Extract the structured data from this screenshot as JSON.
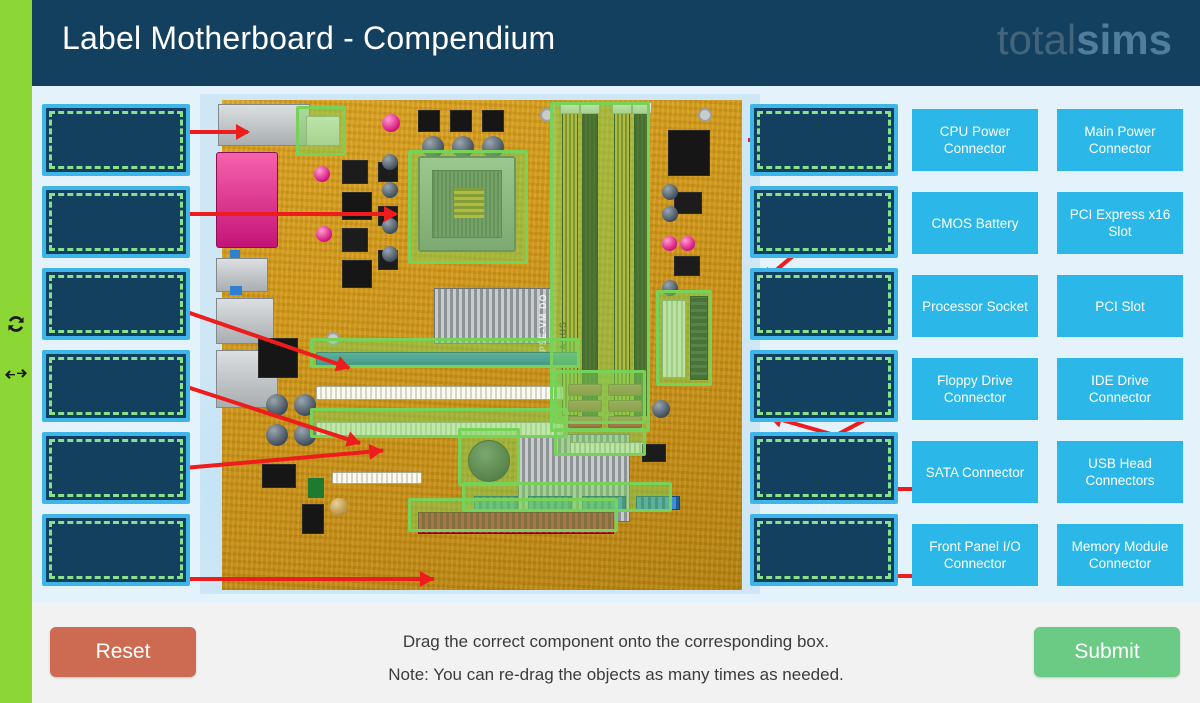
{
  "header": {
    "title": "Label Motherboard - Compendium",
    "logo_light": "total",
    "logo_bold": "sims"
  },
  "rail": {
    "icons": [
      {
        "name": "refresh-icon",
        "label": "refresh"
      },
      {
        "name": "collapse-icon",
        "label": "collapse"
      }
    ]
  },
  "options": [
    {
      "id": "cpu-power-connector",
      "label": "CPU Power Connector"
    },
    {
      "id": "main-power-connector",
      "label": "Main Power Connector"
    },
    {
      "id": "cmos-battery",
      "label": "CMOS Battery"
    },
    {
      "id": "pci-express-x16-slot",
      "label": "PCI Express x16 Slot"
    },
    {
      "id": "processor-socket",
      "label": "Processor Socket"
    },
    {
      "id": "pci-slot",
      "label": "PCI Slot"
    },
    {
      "id": "floppy-drive-connector",
      "label": "Floppy Drive Connector"
    },
    {
      "id": "ide-drive-connector",
      "label": "IDE Drive Connector"
    },
    {
      "id": "sata-connector",
      "label": "SATA Connector"
    },
    {
      "id": "usb-head-connectors",
      "label": "USB Head Connectors"
    },
    {
      "id": "front-panel-io-connector",
      "label": "Front Panel I/O Connector"
    },
    {
      "id": "memory-module-connector",
      "label": "Memory Module Connector"
    }
  ],
  "dropzones_left": [
    "",
    "",
    "",
    "",
    "",
    ""
  ],
  "dropzones_right": [
    "",
    "",
    "",
    "",
    "",
    ""
  ],
  "board": {
    "silkscreen_model": "P5E-VM DO",
    "silkscreen_brand": "ASUS"
  },
  "footer": {
    "reset_label": "Reset",
    "submit_label": "Submit",
    "instruction_1": "Drag the correct component onto the corresponding box.",
    "instruction_2": "Note: You can re-drag the objects as many times as needed."
  },
  "colors": {
    "header_bg": "#14405F",
    "rail_green": "#8CD736",
    "stage_bg": "#E3F2FB",
    "footer_bg": "#F2F2F2",
    "option_blue": "#2BB8E8",
    "dropbox_fill": "#12405E",
    "dropbox_border": "#3EB5E8",
    "dropbox_dash": "#8BE08B",
    "highlight_green": "#77D25A",
    "arrow_red": "#EE1C1C",
    "reset_red": "#CC6B52",
    "submit_green": "#6BCB85"
  }
}
